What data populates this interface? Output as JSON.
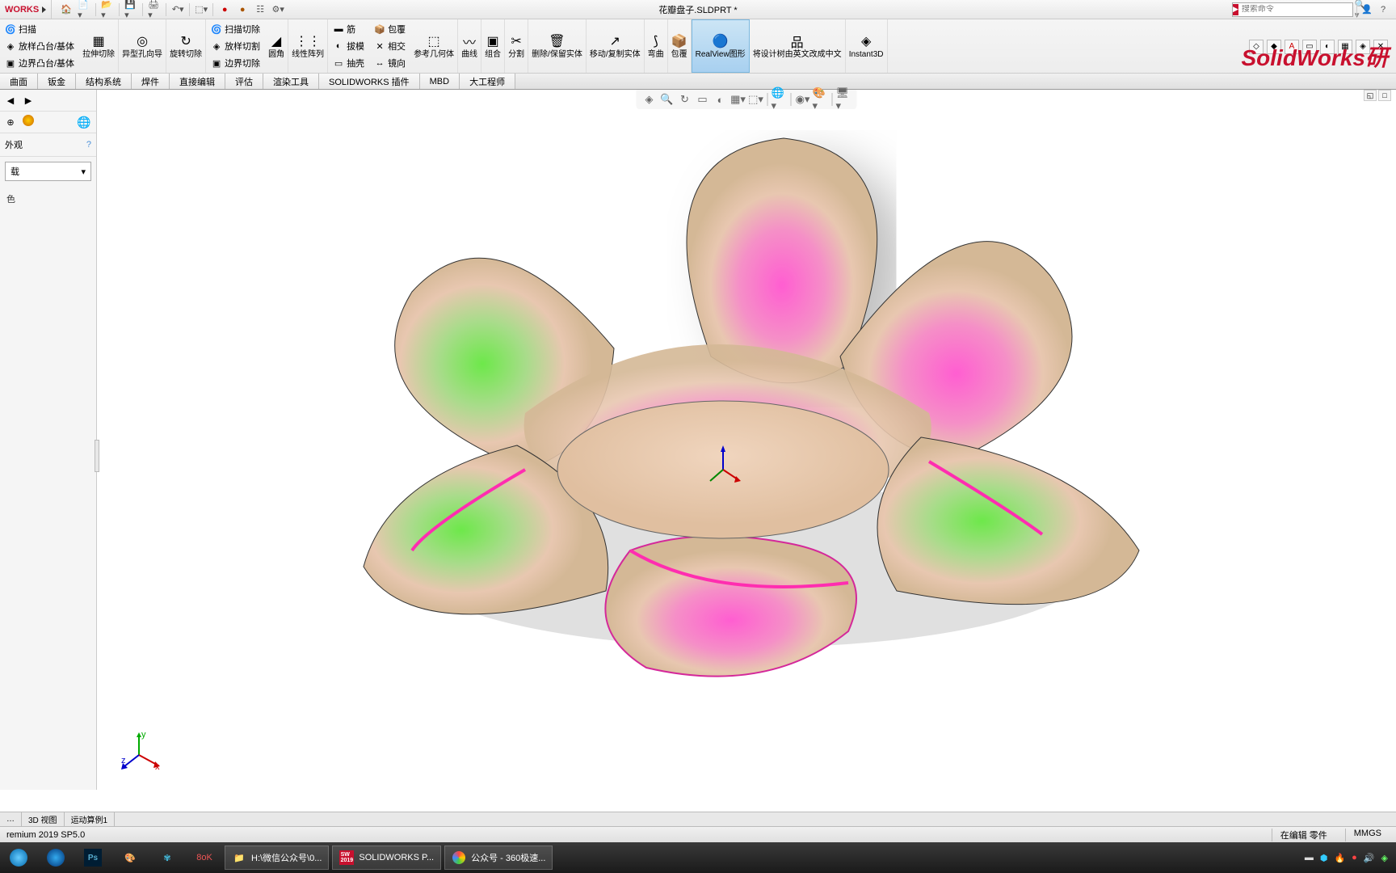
{
  "titlebar": {
    "logo": "WORKS",
    "doc_title": "花瓣盘子.SLDPRT *",
    "search_placeholder": "搜索命令"
  },
  "qat_icons": [
    "home",
    "new",
    "open",
    "save",
    "print",
    "undo",
    "select",
    "rebuild",
    "red-dot",
    "props",
    "options"
  ],
  "ribbon": {
    "col1": [
      {
        "icon": "🌀",
        "label": "扫描"
      },
      {
        "icon": "◈",
        "label": "放样凸台/基体"
      },
      {
        "icon": "▣",
        "label": "边界凸台/基体"
      }
    ],
    "groups": [
      {
        "icon": "▦",
        "label": "拉伸切除"
      },
      {
        "icon": "◎",
        "label": "异型孔向导"
      },
      {
        "icon": "↻",
        "label": "旋转切除"
      }
    ],
    "col3": [
      {
        "icon": "🌀",
        "label": "扫描切除"
      },
      {
        "icon": "◈",
        "label": "放样切割"
      },
      {
        "icon": "▣",
        "label": "边界切除"
      }
    ],
    "mid": [
      {
        "icon": "◢",
        "label": "圆角"
      },
      {
        "icon": "⋮⋮",
        "label": "线性阵列"
      },
      {
        "icon": "▬",
        "label": "筋"
      },
      {
        "icon": "◐",
        "label": "拔模"
      },
      {
        "icon": "▭",
        "label": "抽壳"
      },
      {
        "icon": "📦",
        "label": "包覆"
      },
      {
        "icon": "✕",
        "label": "相交"
      },
      {
        "icon": "↔",
        "label": "镜向"
      }
    ],
    "right": [
      {
        "icon": "⬚",
        "label": "参考几何体"
      },
      {
        "icon": "〰",
        "label": "曲线"
      },
      {
        "icon": "▣",
        "label": "组合"
      },
      {
        "icon": "✂",
        "label": "分割"
      },
      {
        "icon": "🗑",
        "label": "删除/保留实体"
      },
      {
        "icon": "↗",
        "label": "移动/复制实体"
      },
      {
        "icon": "⟆",
        "label": "弯曲"
      },
      {
        "icon": "📦",
        "label": "包覆"
      }
    ],
    "far_right": [
      {
        "icon": "🔵",
        "label": "RealView图形",
        "active": true
      },
      {
        "icon": "品",
        "label": "将设计树由英文改成中文"
      },
      {
        "icon": "3D",
        "label": "Instant3D"
      }
    ]
  },
  "overlay_icons": [
    "◇",
    "◆",
    "A",
    "▭",
    "◐",
    "▦",
    "◈",
    "✕"
  ],
  "tabs": [
    "曲面",
    "钣金",
    "结构系统",
    "焊件",
    "直接编辑",
    "评估",
    "渲染工具",
    "SOLIDWORKS 插件",
    "MBD",
    "大工程师"
  ],
  "sidebar": {
    "title": "外观",
    "dropdown": "载",
    "label": "色"
  },
  "heads_up": [
    "◈",
    "🔍",
    "↻",
    "▭",
    "◐",
    "▦",
    "⬚",
    "·",
    "🌐",
    "·",
    "◉",
    "🎨",
    "·",
    "🖥"
  ],
  "doc_tabs": [
    "…",
    "3D 视图",
    "运动算例1"
  ],
  "status": {
    "version": "remium 2019 SP5.0",
    "editing": "在编辑 零件",
    "units": "MMGS"
  },
  "watermark": "SolidWorks研",
  "taskbar": {
    "tasks": [
      {
        "icon": "📁",
        "label": "H:\\微信公众号\\0...",
        "color": "#ffc04a"
      },
      {
        "icon": "SW",
        "label": "SOLIDWORKS P...",
        "color": "#c8102e"
      },
      {
        "icon": "◉",
        "label": "公众号 - 360极速...",
        "color": "#4ad04a"
      }
    ]
  }
}
